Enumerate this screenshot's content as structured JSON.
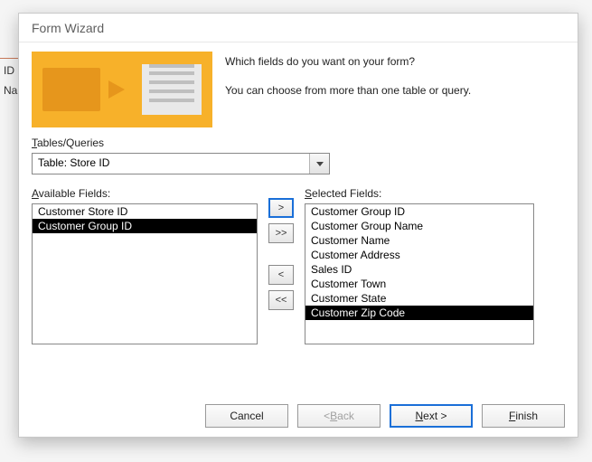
{
  "background": {
    "col1": "ID",
    "col2": "Nam"
  },
  "dialog": {
    "title": "Form Wizard",
    "intro_line1": "Which fields do you want on your form?",
    "intro_line2": "You can choose from more than one table or query.",
    "tables_label": "Tables/Queries",
    "tables_value": "Table: Store ID",
    "available_label": "Available Fields:",
    "selected_label": "Selected Fields:",
    "available_items": [
      {
        "text": "Customer Store ID",
        "selected": false
      },
      {
        "text": "Customer Group ID",
        "selected": true
      }
    ],
    "selected_items": [
      {
        "text": "Customer Group ID",
        "selected": false
      },
      {
        "text": "Customer Group Name",
        "selected": false
      },
      {
        "text": "Customer Name",
        "selected": false
      },
      {
        "text": "Customer Address",
        "selected": false
      },
      {
        "text": "Sales ID",
        "selected": false
      },
      {
        "text": "Customer Town",
        "selected": false
      },
      {
        "text": "Customer State",
        "selected": false
      },
      {
        "text": "Customer Zip Code",
        "selected": true
      }
    ],
    "move": {
      "add": ">",
      "add_all": ">>",
      "remove": "<",
      "remove_all": "<<"
    },
    "buttons": {
      "cancel": "Cancel",
      "back": "< Back",
      "back_label_prefix": "< ",
      "back_label_mn": "B",
      "back_label_rest": "ack",
      "next_label_mn": "N",
      "next_label_rest": "ext >",
      "finish_label_mn": "F",
      "finish_label_rest": "inish"
    }
  }
}
